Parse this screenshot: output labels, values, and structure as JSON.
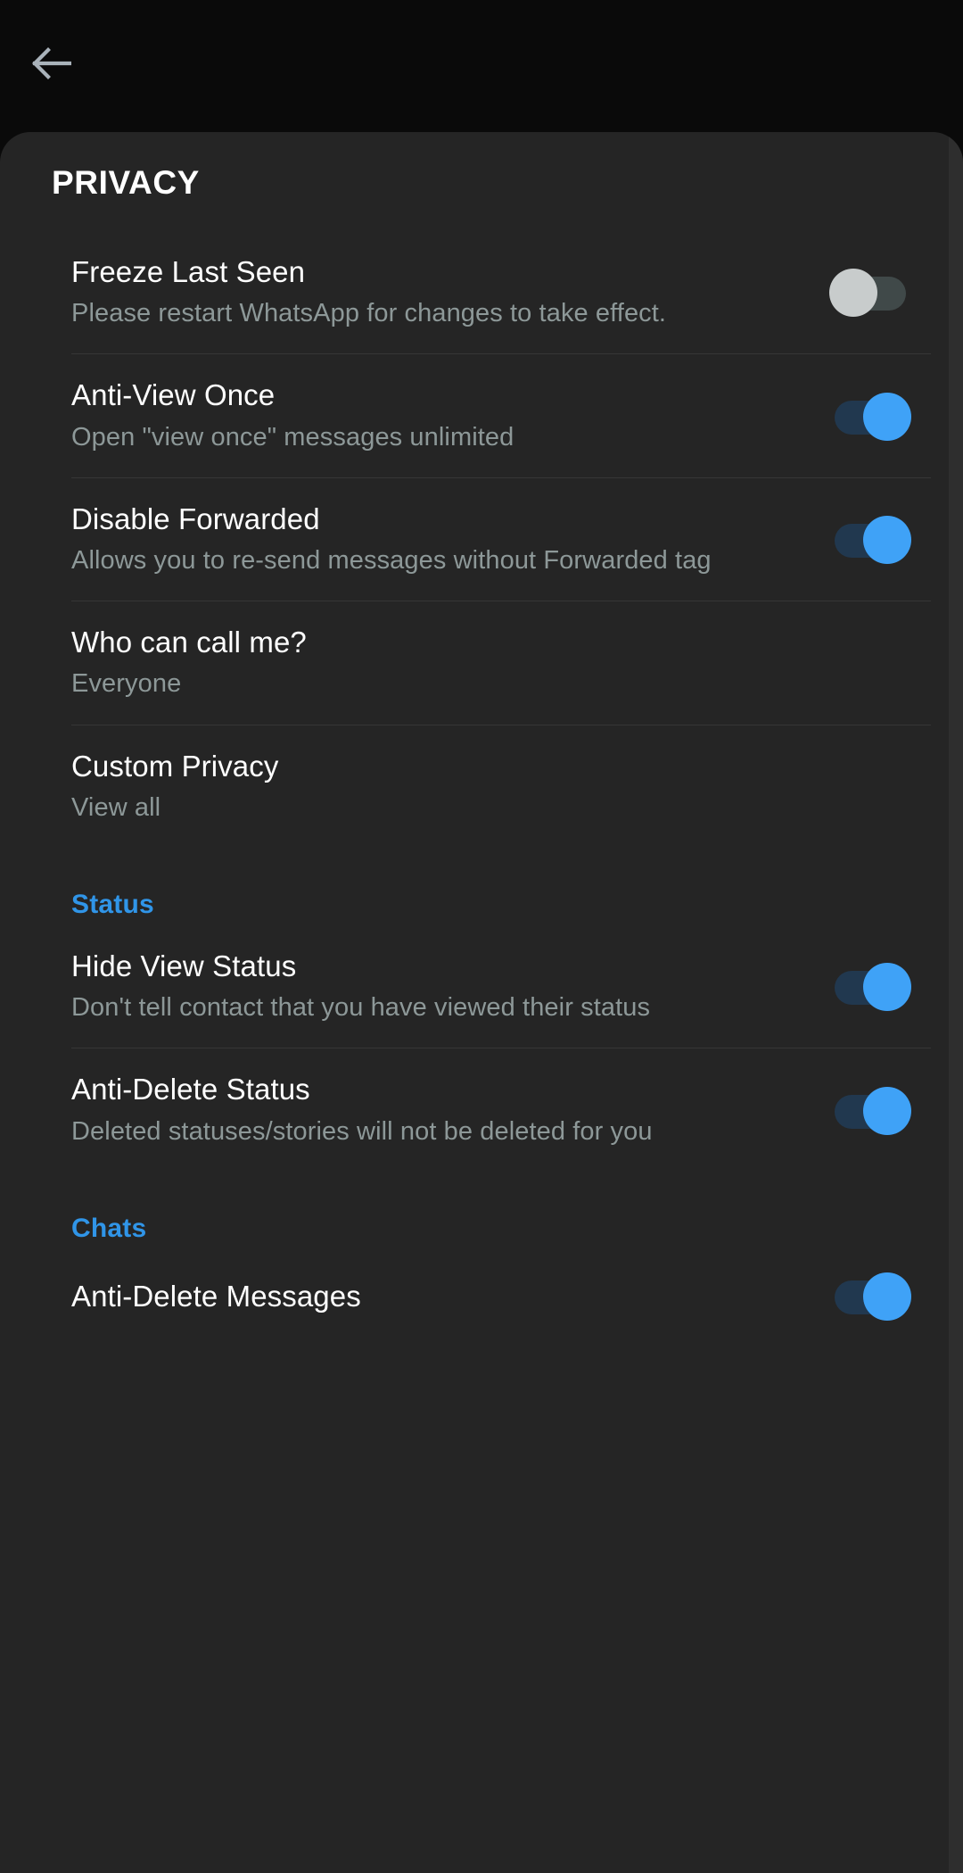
{
  "appbar": {
    "back_icon": "arrow-left-icon"
  },
  "page": {
    "title": "PRIVACY"
  },
  "colors": {
    "accent_blue": "#3095e8",
    "toggle_on_thumb": "#3fa2f7",
    "toggle_on_track": "#21384f",
    "toggle_off_thumb": "#c8cccc",
    "toggle_off_track": "#404949",
    "card_bg": "#252525",
    "appbar_bg": "#0a0a0a",
    "title_text": "#ffffff",
    "subtitle_text": "#8d9898"
  },
  "items": [
    {
      "title": "Freeze Last Seen",
      "subtitle": "Please restart WhatsApp for changes to take effect.",
      "control": "toggle",
      "state": "off"
    },
    {
      "title": "Anti-View Once",
      "subtitle": "Open \"view once\" messages unlimited",
      "control": "toggle",
      "state": "on"
    },
    {
      "title": "Disable Forwarded",
      "subtitle": "Allows you to re-send messages without Forwarded tag",
      "control": "toggle",
      "state": "on"
    },
    {
      "title": "Who can call me?",
      "subtitle": "Everyone",
      "control": "none",
      "state": ""
    },
    {
      "title": "Custom Privacy",
      "subtitle": "View all",
      "control": "none",
      "state": ""
    }
  ],
  "status_section": {
    "header": "Status",
    "items": [
      {
        "title": "Hide View Status",
        "subtitle": "Don't tell contact that you have viewed their status",
        "control": "toggle",
        "state": "on"
      },
      {
        "title": "Anti-Delete Status",
        "subtitle": "Deleted statuses/stories will not be deleted for you",
        "control": "toggle",
        "state": "on"
      }
    ]
  },
  "chats_section": {
    "header": "Chats",
    "items": [
      {
        "title": "Anti-Delete Messages",
        "subtitle": "",
        "control": "toggle",
        "state": "on"
      }
    ]
  }
}
